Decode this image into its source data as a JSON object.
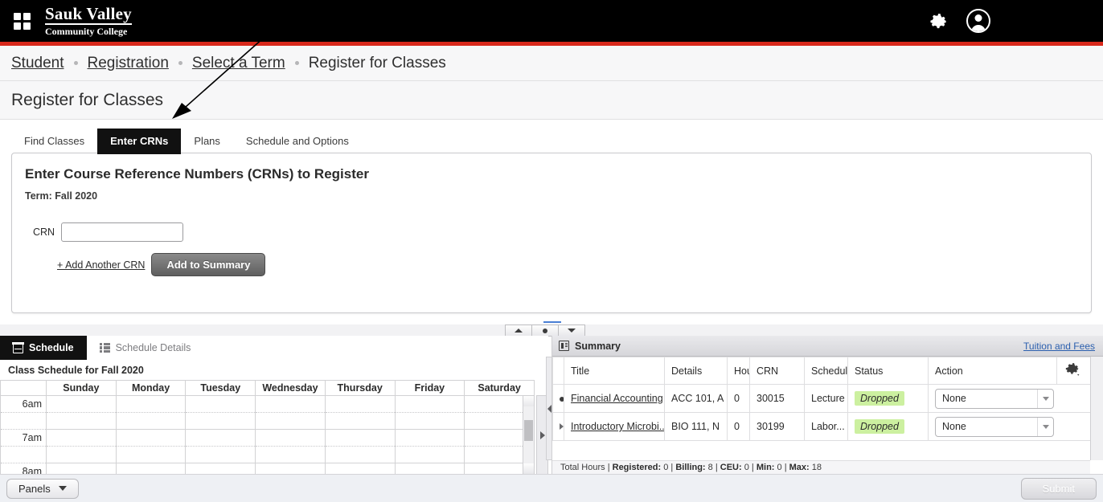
{
  "topbar": {
    "apps_icon": "grid-apps-icon",
    "brand_line1": "Sauk Valley",
    "brand_line2": "Community College",
    "settings_icon": "gear-icon",
    "profile_icon": "user-avatar-icon"
  },
  "breadcrumb": {
    "items": [
      {
        "label": "Student",
        "link": true
      },
      {
        "label": "Registration",
        "link": true
      },
      {
        "label": "Select a Term",
        "link": true
      },
      {
        "label": "Register for Classes",
        "link": false
      }
    ]
  },
  "page": {
    "title": "Register for Classes"
  },
  "tabs": [
    {
      "label": "Find Classes",
      "active": false
    },
    {
      "label": "Enter CRNs",
      "active": true
    },
    {
      "label": "Plans",
      "active": false
    },
    {
      "label": "Schedule and Options",
      "active": false
    }
  ],
  "crn_panel": {
    "heading": "Enter Course Reference Numbers (CRNs) to Register",
    "term": "Term: Fall 2020",
    "crn_label": "CRN",
    "crn_value": "",
    "crn_placeholder": "",
    "add_another_label": "+ Add Another CRN",
    "add_to_summary_label": "Add to Summary"
  },
  "splitter": {
    "up_icon": "panel-expand-up-icon",
    "dot_icon": "panel-restore-icon",
    "down_icon": "panel-collapse-down-icon"
  },
  "schedule_panel": {
    "tabs": [
      {
        "label": "Schedule",
        "icon": "calendar-icon",
        "active": true
      },
      {
        "label": "Schedule Details",
        "icon": "list-icon",
        "active": false
      }
    ],
    "title": "Class Schedule for Fall 2020",
    "day_headers": [
      "",
      "Sunday",
      "Monday",
      "Tuesday",
      "Wednesday",
      "Thursday",
      "Friday",
      "Saturday"
    ],
    "time_rows": [
      "6am",
      "7am",
      "8am"
    ],
    "scroll_up_icon": "scroll-up-icon",
    "scroll_down_icon": "scroll-down-icon",
    "collapse_icon": "panel-collapse-right-icon"
  },
  "summary_panel": {
    "title": "Summary",
    "title_icon": "summary-icon",
    "tuition_link": "Tuition and Fees",
    "settings_icon": "gear-dropdown-icon",
    "columns": [
      "Title",
      "Details",
      "Hour",
      "CRN",
      "Schedule",
      "Status",
      "Action"
    ],
    "rows": [
      {
        "marker": "dot",
        "title": "Financial Accounting",
        "details": "ACC 101, A",
        "hours": "0",
        "crn": "30015",
        "schedule": "Lecture",
        "status": "Dropped",
        "action": "None"
      },
      {
        "marker": "triangle",
        "title": "Introductory Microbi...",
        "details": "BIO 111, N",
        "hours": "0",
        "crn": "30199",
        "schedule": "Labor...",
        "status": "Dropped",
        "action": "None"
      }
    ],
    "footer": {
      "label": "Total Hours",
      "registered_label": "Registered:",
      "registered_value": "0",
      "billing_label": "Billing:",
      "billing_value": "8",
      "ceu_label": "CEU:",
      "ceu_value": "0",
      "min_label": "Min:",
      "min_value": "0",
      "max_label": "Max:",
      "max_value": "18"
    }
  },
  "bottom_bar": {
    "panels_label": "Panels",
    "submit_label": "Submit"
  },
  "colors": {
    "header_black": "#000000",
    "accent_red": "#d9291c",
    "status_green": "#ccf0a0",
    "link_blue": "#2b5fae"
  }
}
